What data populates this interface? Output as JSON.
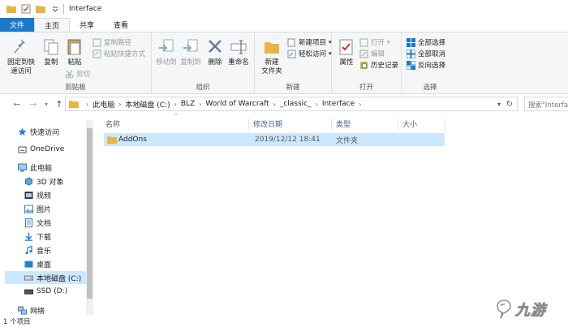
{
  "window": {
    "title": "Interface"
  },
  "tabs": [
    {
      "label": "文件"
    },
    {
      "label": "主页"
    },
    {
      "label": "共享"
    },
    {
      "label": "查看"
    }
  ],
  "ribbon": {
    "clipboard": {
      "pin_label": "固定到快\n速访问",
      "copy_label": "复制",
      "paste_label": "粘贴",
      "copy_path_label": "复制路径",
      "paste_shortcut_label": "粘贴快捷方式",
      "cut_label": "剪切",
      "group_label": "剪贴板"
    },
    "organize": {
      "move_to_label": "移动到",
      "copy_to_label": "复制到",
      "delete_label": "删除",
      "rename_label": "重命名",
      "group_label": "组织"
    },
    "new": {
      "new_folder_label": "新建\n文件夹",
      "new_item_label": "新建项目",
      "easy_access_label": "轻松访问",
      "group_label": "新建"
    },
    "open": {
      "properties_label": "属性",
      "open_label": "打开",
      "edit_label": "编辑",
      "history_label": "历史记录",
      "group_label": "打开"
    },
    "select": {
      "select_all_label": "全部选择",
      "select_none_label": "全部取消",
      "invert_label": "反向选择",
      "group_label": "选择"
    }
  },
  "address": {
    "crumbs": [
      "此电脑",
      "本地磁盘 (C:)",
      "BLZ",
      "World of Warcraft",
      "_classic_",
      "Interface"
    ],
    "search_placeholder": "搜索\"Interface\""
  },
  "nav": {
    "quick_access": "快速访问",
    "onedrive": "OneDrive",
    "this_pc": "此电脑",
    "objects_3d": "3D 对象",
    "videos": "视频",
    "pictures": "图片",
    "documents": "文档",
    "downloads": "下载",
    "music": "音乐",
    "desktop": "桌面",
    "local_disk": "本地磁盘 (C:)",
    "ssd": "SSD (D:)",
    "network": "网络"
  },
  "columns": {
    "name": "名称",
    "modified": "修改日期",
    "type": "类型",
    "size": "大小"
  },
  "files": [
    {
      "name": "AddOns",
      "modified": "2019/12/12 18:41",
      "type": "文件夹",
      "size": ""
    }
  ],
  "status": {
    "count": "1 个项目"
  },
  "watermark": {
    "text": "九游"
  },
  "colors": {
    "accent": "#1979ca",
    "selection": "#cce8ff",
    "folder": "#e8b446"
  }
}
